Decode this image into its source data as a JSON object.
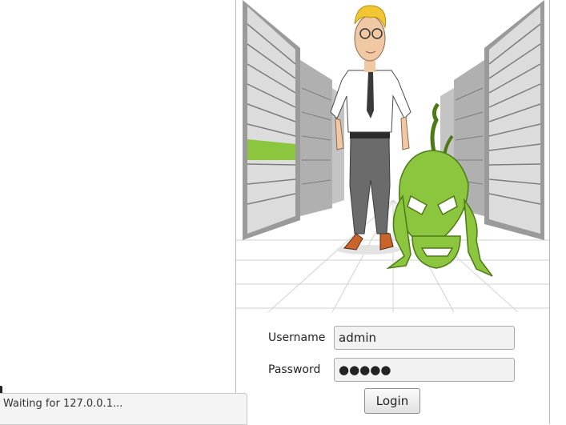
{
  "login_form": {
    "username_label": "Username",
    "username_value": "admin",
    "password_label": "Password",
    "password_value": "●●●●●",
    "login_label": "Login"
  },
  "status_bar": {
    "text": "Waiting for 127.0.0.1..."
  },
  "colors": {
    "accent_green": "#8cc63f",
    "rack_grey": "#8a8a8a",
    "shirt": "#ffffff",
    "trousers": "#6b6b6b"
  }
}
